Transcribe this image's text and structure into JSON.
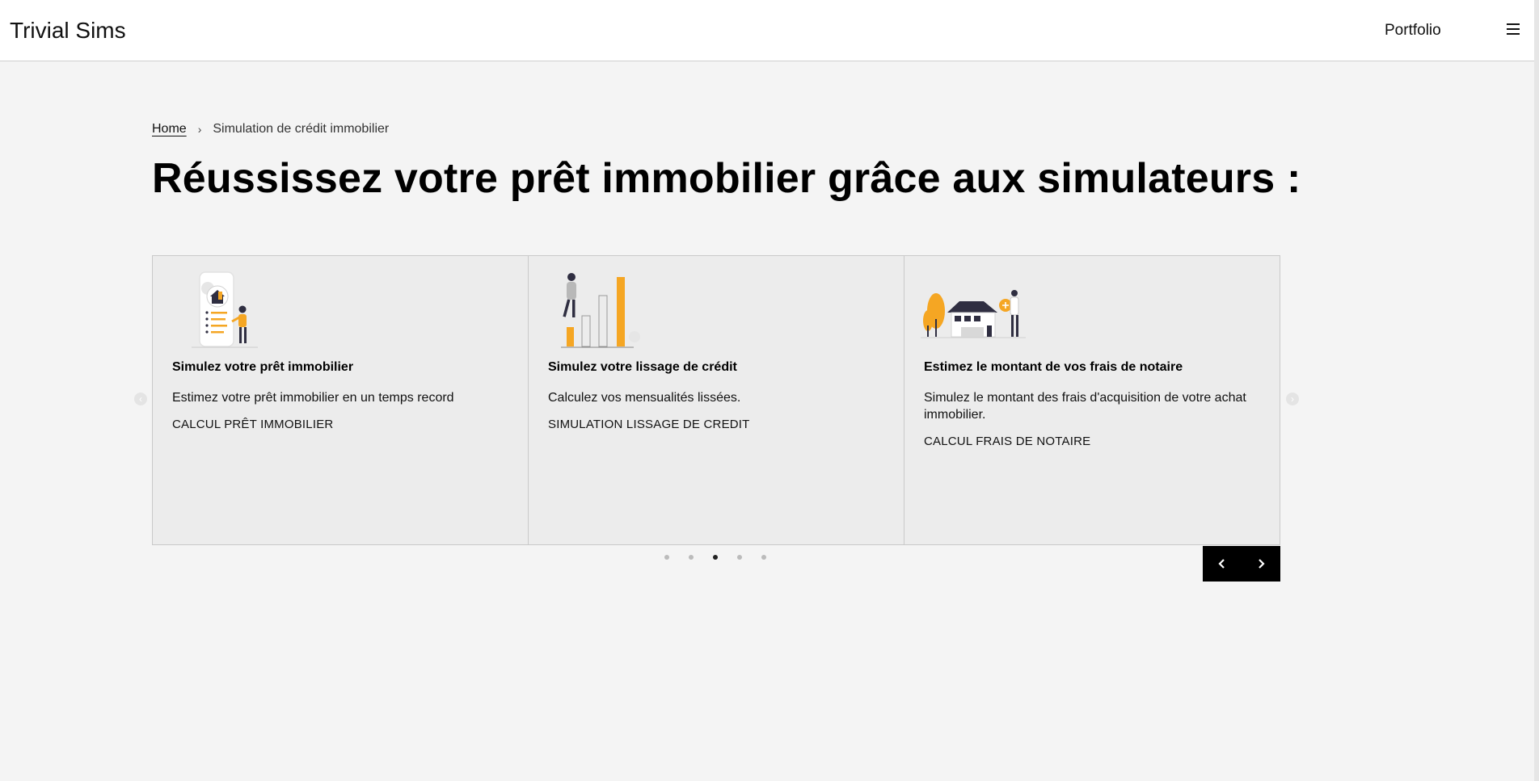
{
  "header": {
    "brand": "Trivial Sims",
    "nav_link": "Portfolio",
    "menu_icon": "hamburger-icon"
  },
  "breadcrumb": {
    "home": "Home",
    "separator": "›",
    "current": "Simulation de crédit immobilier"
  },
  "page_title": "Réussissez votre prêt immobilier grâce aux simulateurs :",
  "cards": [
    {
      "illustration": "mobile-house-illustration",
      "title": "Simulez votre prêt immobilier",
      "description": "Estimez votre prêt immobilier en un temps record",
      "cta": "CALCUL PRÊT IMMOBILIER"
    },
    {
      "illustration": "growth-bars-illustration",
      "title": "Simulez votre lissage de crédit",
      "description": "Calculez vos mensualités lissées.",
      "cta": "SIMULATION LISSAGE DE CREDIT"
    },
    {
      "illustration": "house-trees-illustration",
      "title": "Estimez le montant de vos frais de notaire",
      "description": "Simulez le montant des frais d'acquisition de votre achat immobilier.",
      "cta": "CALCUL FRAIS DE NOTAIRE"
    }
  ],
  "carousel": {
    "page_count": 5,
    "active_page": 3,
    "prev_icon": "chevron-left-icon",
    "next_icon": "chevron-right-icon"
  },
  "colors": {
    "accent": "#f5a623",
    "dark": "#2f2e41",
    "background": "#f4f4f4",
    "card": "#ececec"
  }
}
